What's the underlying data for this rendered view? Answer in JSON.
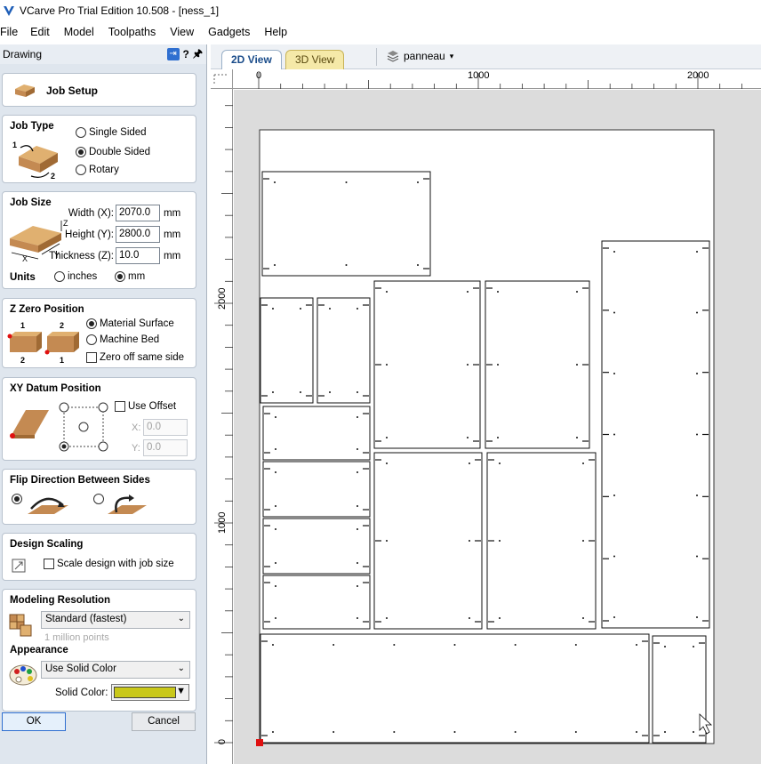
{
  "window": {
    "title": "VCarve Pro Trial Edition 10.508 - [ness_1]"
  },
  "menu": [
    "File",
    "Edit",
    "Model",
    "Toolpaths",
    "View",
    "Gadgets",
    "Help"
  ],
  "panel": {
    "header": "Drawing",
    "header_help": "?",
    "job_setup_title": "Job Setup",
    "job_type": {
      "title": "Job Type",
      "options": [
        "Single Sided",
        "Double Sided",
        "Rotary"
      ],
      "selected": "Double Sided",
      "diagram_label_1": "1",
      "diagram_label_2": "2"
    },
    "job_size": {
      "title": "Job Size",
      "width_label": "Width (X):",
      "width_value": "2070.0",
      "height_label": "Height (Y):",
      "height_value": "2800.0",
      "thickness_label": "Thickness (Z):",
      "thickness_value": "10.0",
      "unit_mm": "mm",
      "units_label": "Units",
      "unit_options": [
        "inches",
        "mm"
      ],
      "unit_selected": "mm",
      "axis_x": "X",
      "axis_y": "Y",
      "axis_z": "Z"
    },
    "z_zero": {
      "title": "Z Zero Position",
      "options": [
        "Material Surface",
        "Machine Bed"
      ],
      "selected": "Material Surface",
      "checkbox_label": "Zero off same side",
      "checkbox_checked": false,
      "block_labels_top": [
        "1",
        "2"
      ],
      "block_labels_bottom": [
        "2",
        "1"
      ]
    },
    "xy_datum": {
      "title": "XY Datum Position",
      "use_offset_label": "Use Offset",
      "use_offset_checked": false,
      "x_label": "X:",
      "x_value": "0.0",
      "y_label": "Y:",
      "y_value": "0.0"
    },
    "flip": {
      "title": "Flip Direction Between Sides",
      "selected_index": 0
    },
    "scaling": {
      "title": "Design Scaling",
      "checkbox_label": "Scale design with job size",
      "checked": false
    },
    "modeling": {
      "title": "Modeling Resolution",
      "selected": "Standard (fastest)",
      "hint": "1 million points"
    },
    "appearance": {
      "title": "Appearance",
      "selected": "Use Solid Color",
      "solid_color_label": "Solid Color:",
      "solid_color": "#c9c81a"
    },
    "ok_label": "OK",
    "cancel_label": "Cancel"
  },
  "view": {
    "tab_2d": "2D View",
    "tab_3d": "3D View",
    "layer": "panneau",
    "ruler_top": [
      "0",
      "1000",
      "2000"
    ],
    "ruler_left": [
      "2000",
      "1000",
      "0"
    ]
  },
  "colors": {
    "panel_bg": "#dfe6ee",
    "canvas_bg": "#dcdcdc",
    "datum_marker": "#e01010",
    "material_wood": "#c48a52"
  }
}
